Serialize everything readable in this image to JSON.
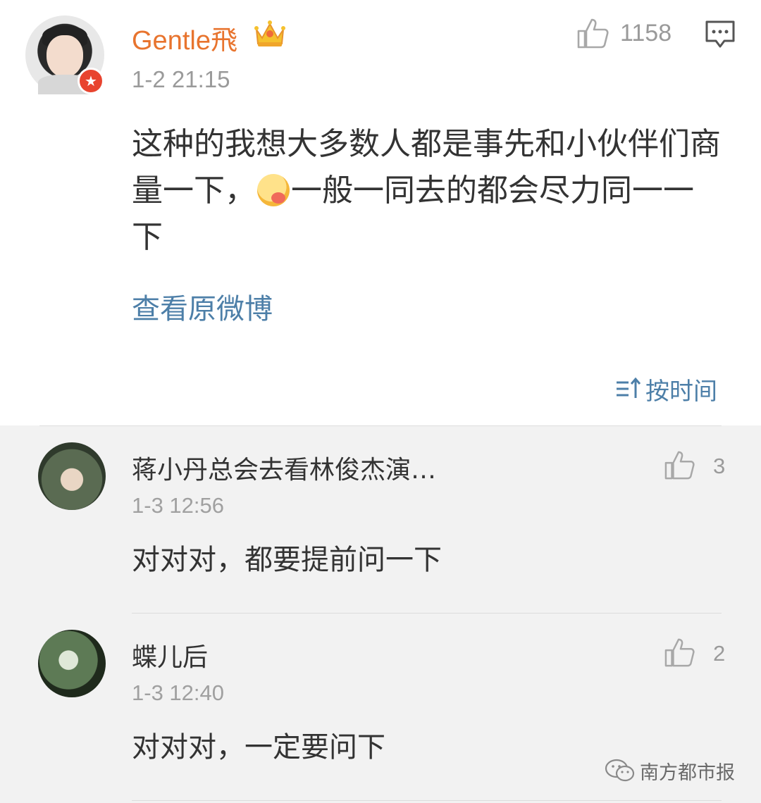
{
  "post": {
    "username": "Gentle飛",
    "timestamp": "1-2 21:15",
    "like_count": "1158",
    "text_before_emoji": "这种的我想大多数人都是事先和小伙伴们商量一下，",
    "text_after_emoji": "一般一同去的都会尽力同一一下",
    "view_original": "查看原微博",
    "icons": {
      "avatar": "user-avatar",
      "badge": "verified-star-badge",
      "crown": "vip-crown-icon",
      "like": "thumbs-up-icon",
      "comment": "comment-icon",
      "emoji": "yummy-face-emoji"
    }
  },
  "sort": {
    "label": "按时间",
    "icon": "sort-icon"
  },
  "replies": [
    {
      "name": "蒋小丹总会去看林俊杰演…",
      "time": "1-3 12:56",
      "text": "对对对，都要提前问一下",
      "likes": "3"
    },
    {
      "name": "蝶儿后",
      "time": "1-3 12:40",
      "text": "对对对，一定要问下",
      "likes": "2"
    }
  ],
  "watermark": {
    "text": "南方都市报",
    "icon": "wechat-icon"
  },
  "colors": {
    "username": "#e8742e",
    "link": "#4d7fa8",
    "reply_bg": "#f2f2f2",
    "badge": "#e8442f"
  }
}
